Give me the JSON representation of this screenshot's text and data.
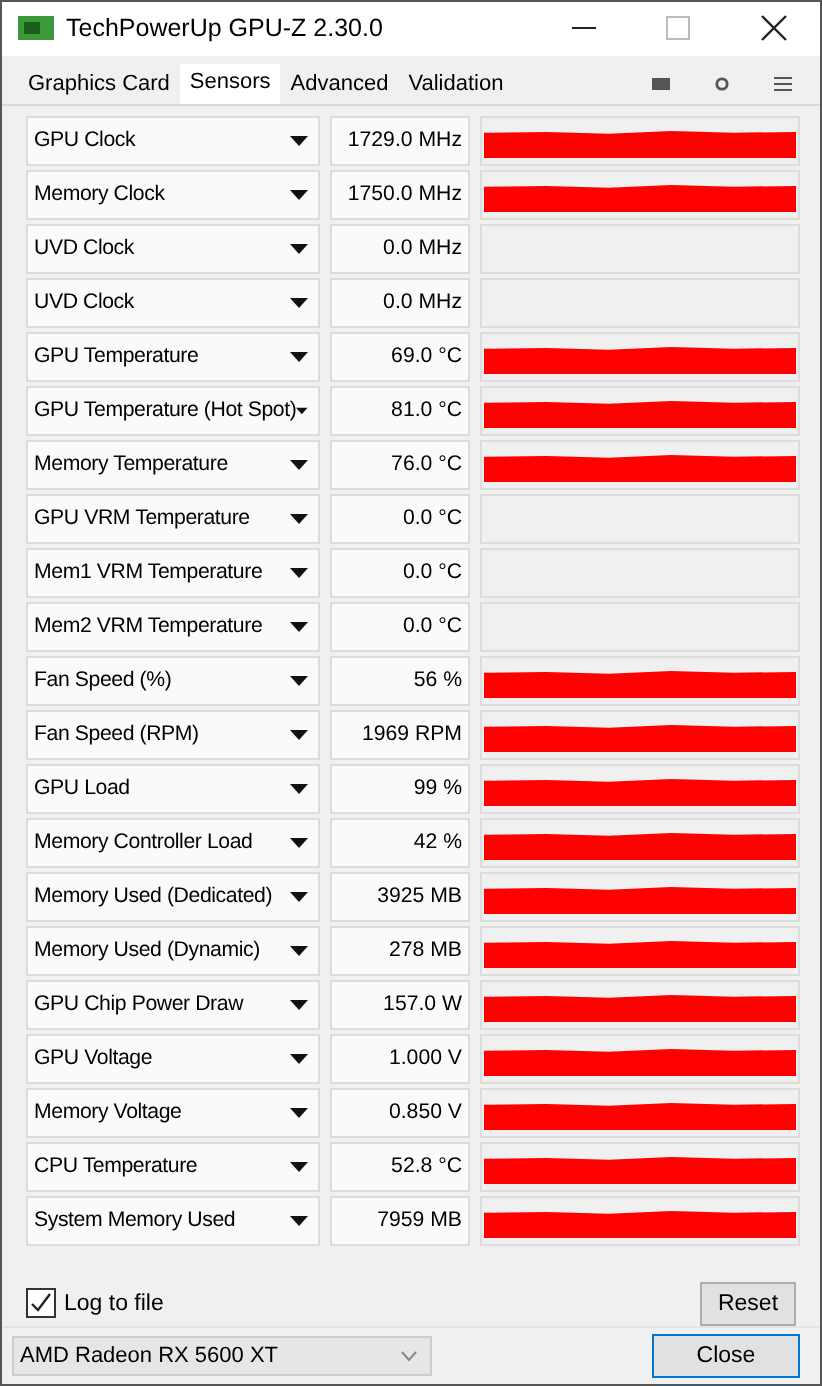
{
  "window": {
    "title": "TechPowerUp GPU-Z 2.30.0"
  },
  "tabs": [
    {
      "label": "Graphics Card",
      "selected": false
    },
    {
      "label": "Sensors",
      "selected": true
    },
    {
      "label": "Advanced",
      "selected": false
    },
    {
      "label": "Validation",
      "selected": false
    }
  ],
  "sensors": [
    {
      "name": "GPU Clock",
      "value": "1729.0 MHz",
      "kind": "graph"
    },
    {
      "name": "Memory Clock",
      "value": "1750.0 MHz",
      "kind": "graph"
    },
    {
      "name": "UVD Clock",
      "value": "0.0 MHz",
      "kind": "empty"
    },
    {
      "name": "UVD Clock",
      "value": "0.0 MHz",
      "kind": "empty"
    },
    {
      "name": "GPU Temperature",
      "value": "69.0 °C",
      "kind": "graph"
    },
    {
      "name": "GPU Temperature (Hot Spot)",
      "value": "81.0 °C",
      "kind": "graph"
    },
    {
      "name": "Memory Temperature",
      "value": "76.0 °C",
      "kind": "graph"
    },
    {
      "name": "GPU VRM Temperature",
      "value": "0.0 °C",
      "kind": "empty"
    },
    {
      "name": "Mem1 VRM Temperature",
      "value": "0.0 °C",
      "kind": "empty"
    },
    {
      "name": "Mem2 VRM Temperature",
      "value": "0.0 °C",
      "kind": "empty"
    },
    {
      "name": "Fan Speed (%)",
      "value": "56 %",
      "kind": "graph"
    },
    {
      "name": "Fan Speed (RPM)",
      "value": "1969 RPM",
      "kind": "graph"
    },
    {
      "name": "GPU Load",
      "value": "99 %",
      "kind": "graph"
    },
    {
      "name": "Memory Controller Load",
      "value": "42 %",
      "kind": "graph"
    },
    {
      "name": "Memory Used (Dedicated)",
      "value": "3925 MB",
      "kind": "graph"
    },
    {
      "name": "Memory Used (Dynamic)",
      "value": "278 MB",
      "kind": "graph"
    },
    {
      "name": "GPU Chip Power Draw",
      "value": "157.0 W",
      "kind": "graph"
    },
    {
      "name": "GPU Voltage",
      "value": "1.000 V",
      "kind": "graph"
    },
    {
      "name": "Memory Voltage",
      "value": "0.850 V",
      "kind": "graph"
    },
    {
      "name": "CPU Temperature",
      "value": "52.8 °C",
      "kind": "graph"
    },
    {
      "name": "System Memory Used",
      "value": "7959 MB",
      "kind": "graph"
    }
  ],
  "log_to_file": {
    "label": "Log to file",
    "checked": true
  },
  "reset_button": "Reset",
  "gpu_select": {
    "value": "AMD Radeon RX 5600 XT"
  },
  "close_button": "Close"
}
